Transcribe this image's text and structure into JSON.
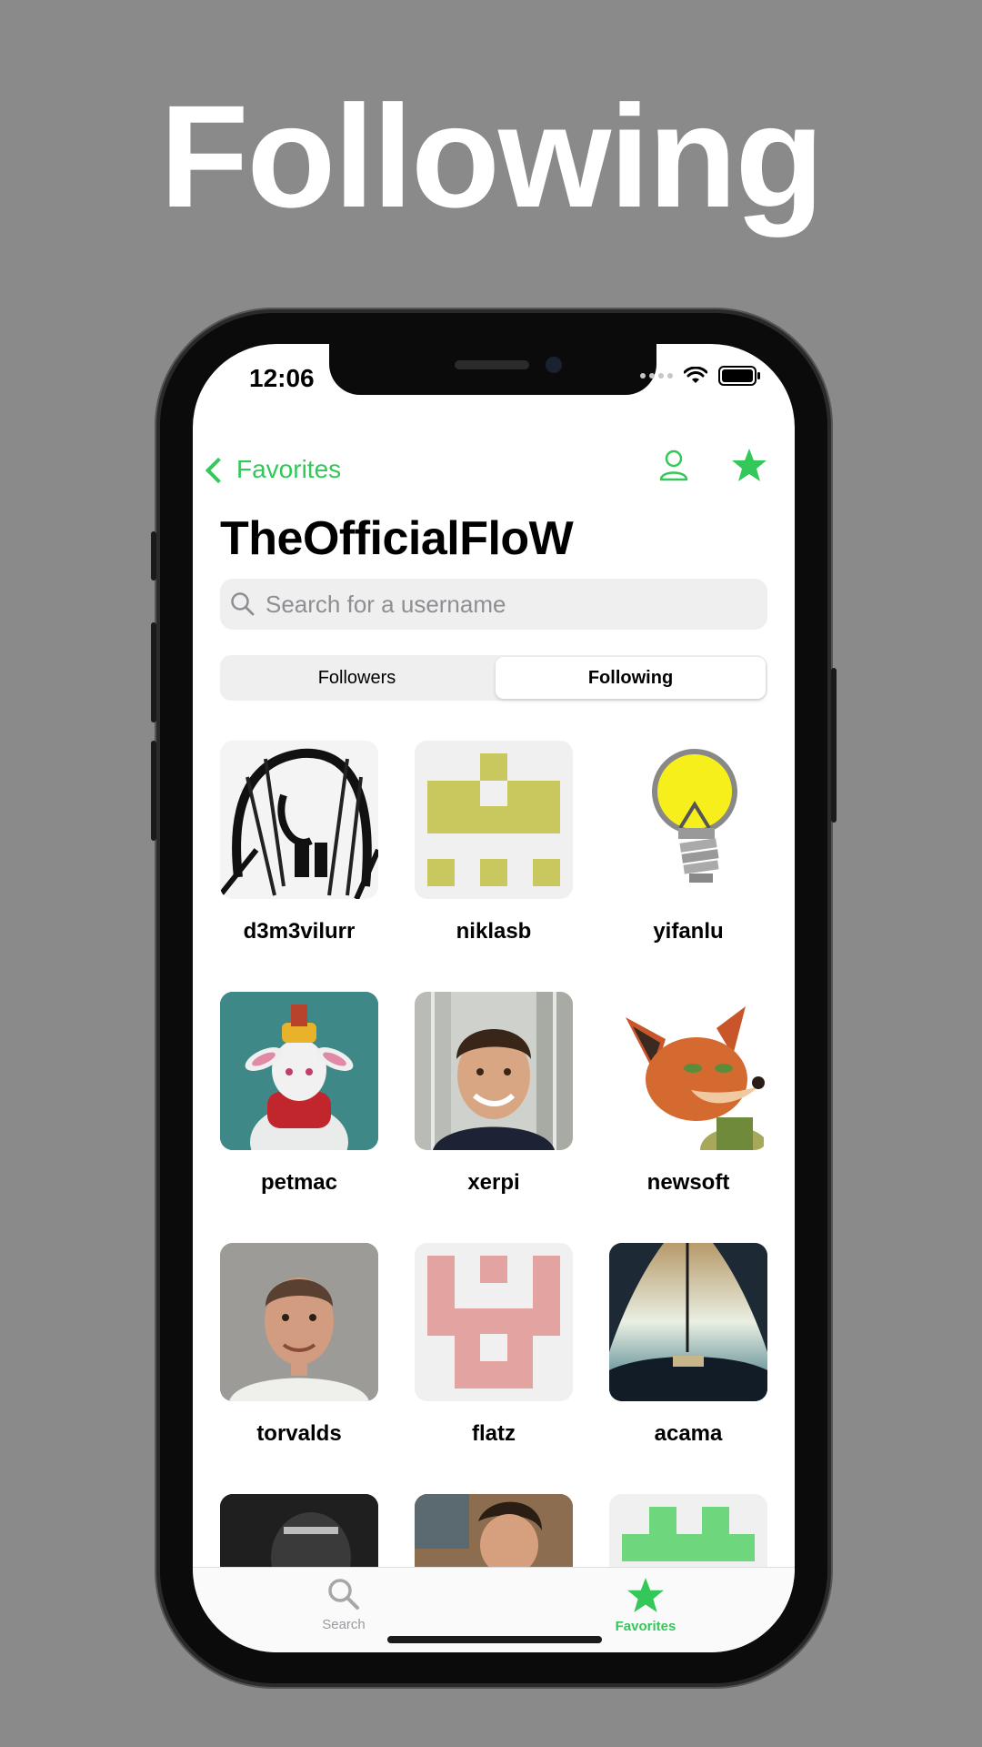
{
  "hero": {
    "title": "Following"
  },
  "status": {
    "time": "12:06"
  },
  "nav": {
    "back_label": "Favorites"
  },
  "page": {
    "title": "TheOfficialFloW"
  },
  "search": {
    "placeholder": "Search for a username"
  },
  "segments": {
    "followers": "Followers",
    "following": "Following"
  },
  "users": [
    {
      "name": "d3m3vilurr",
      "avatar": "sketch-face"
    },
    {
      "name": "niklasb",
      "avatar": "identicon-olive"
    },
    {
      "name": "yifanlu",
      "avatar": "lightbulb"
    },
    {
      "name": "petmac",
      "avatar": "bunny"
    },
    {
      "name": "xerpi",
      "avatar": "boy-photo"
    },
    {
      "name": "newsoft",
      "avatar": "fox"
    },
    {
      "name": "torvalds",
      "avatar": "man-photo"
    },
    {
      "name": "flatz",
      "avatar": "identicon-pink"
    },
    {
      "name": "acama",
      "avatar": "cockpit"
    }
  ],
  "tabs": {
    "search": "Search",
    "favorites": "Favorites"
  },
  "colors": {
    "accent": "#34c759",
    "background": "#8a8a8a"
  }
}
